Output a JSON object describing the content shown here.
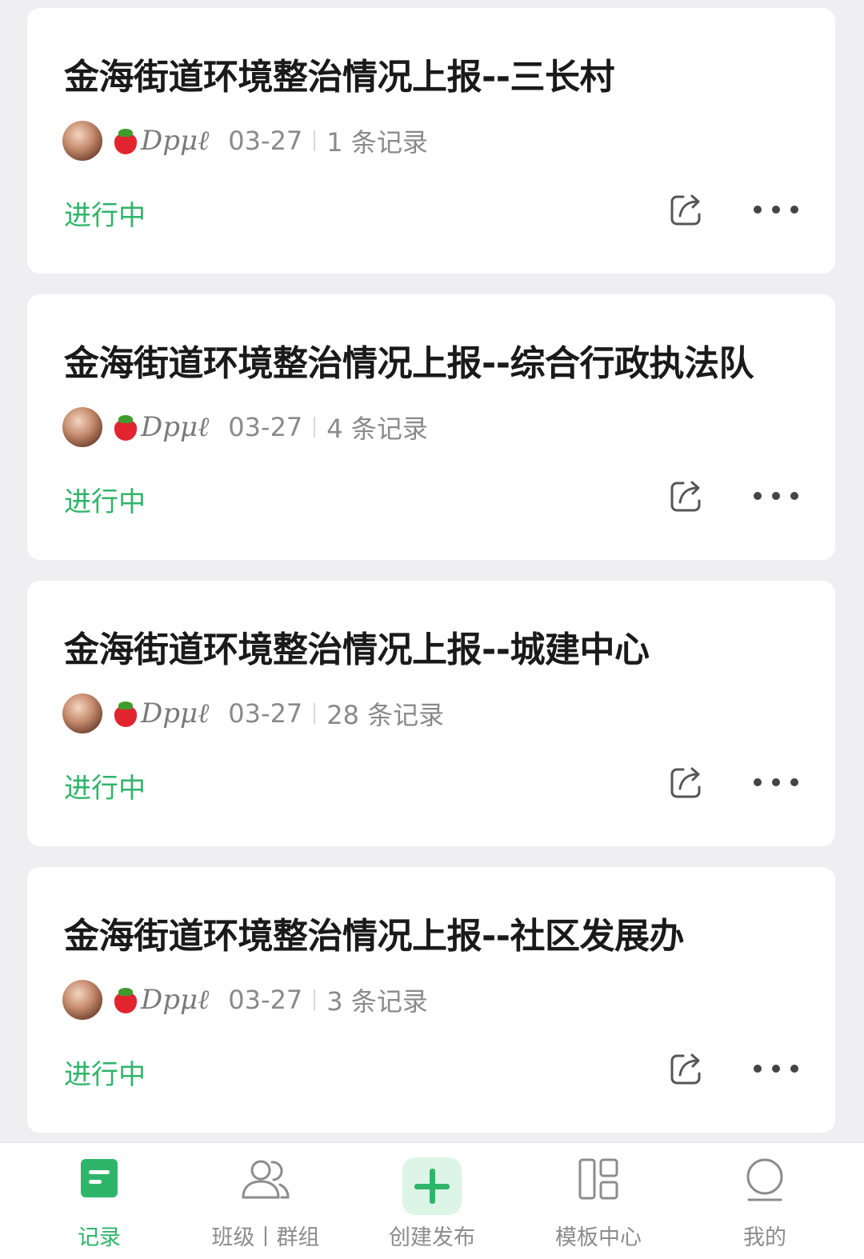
{
  "cards": [
    {
      "title": "金海街道环境整治情况上报--三长村",
      "author": "Dpμℓ",
      "date": "03-27",
      "records": "1 条记录",
      "status": "进行中"
    },
    {
      "title": "金海街道环境整治情况上报--综合行政执法队",
      "author": "Dpμℓ",
      "date": "03-27",
      "records": "4 条记录",
      "status": "进行中"
    },
    {
      "title": "金海街道环境整治情况上报--城建中心",
      "author": "Dpμℓ",
      "date": "03-27",
      "records": "28 条记录",
      "status": "进行中"
    },
    {
      "title": "金海街道环境整治情况上报--社区发展办",
      "author": "Dpμℓ",
      "date": "03-27",
      "records": "3 条记录",
      "status": "进行中"
    }
  ],
  "tabbar": [
    {
      "label": "记录",
      "icon": "record-icon",
      "active": true
    },
    {
      "label": "班级丨群组",
      "icon": "group-icon",
      "active": false
    },
    {
      "label": "创建发布",
      "icon": "plus-icon",
      "active": false
    },
    {
      "label": "模板中心",
      "icon": "template-icon",
      "active": false
    },
    {
      "label": "我的",
      "icon": "profile-icon",
      "active": false
    }
  ],
  "colors": {
    "accent": "#2fb56a",
    "background": "#efeff2",
    "card": "#ffffff",
    "title": "#1a1a1a",
    "meta": "#8a8a8a"
  }
}
